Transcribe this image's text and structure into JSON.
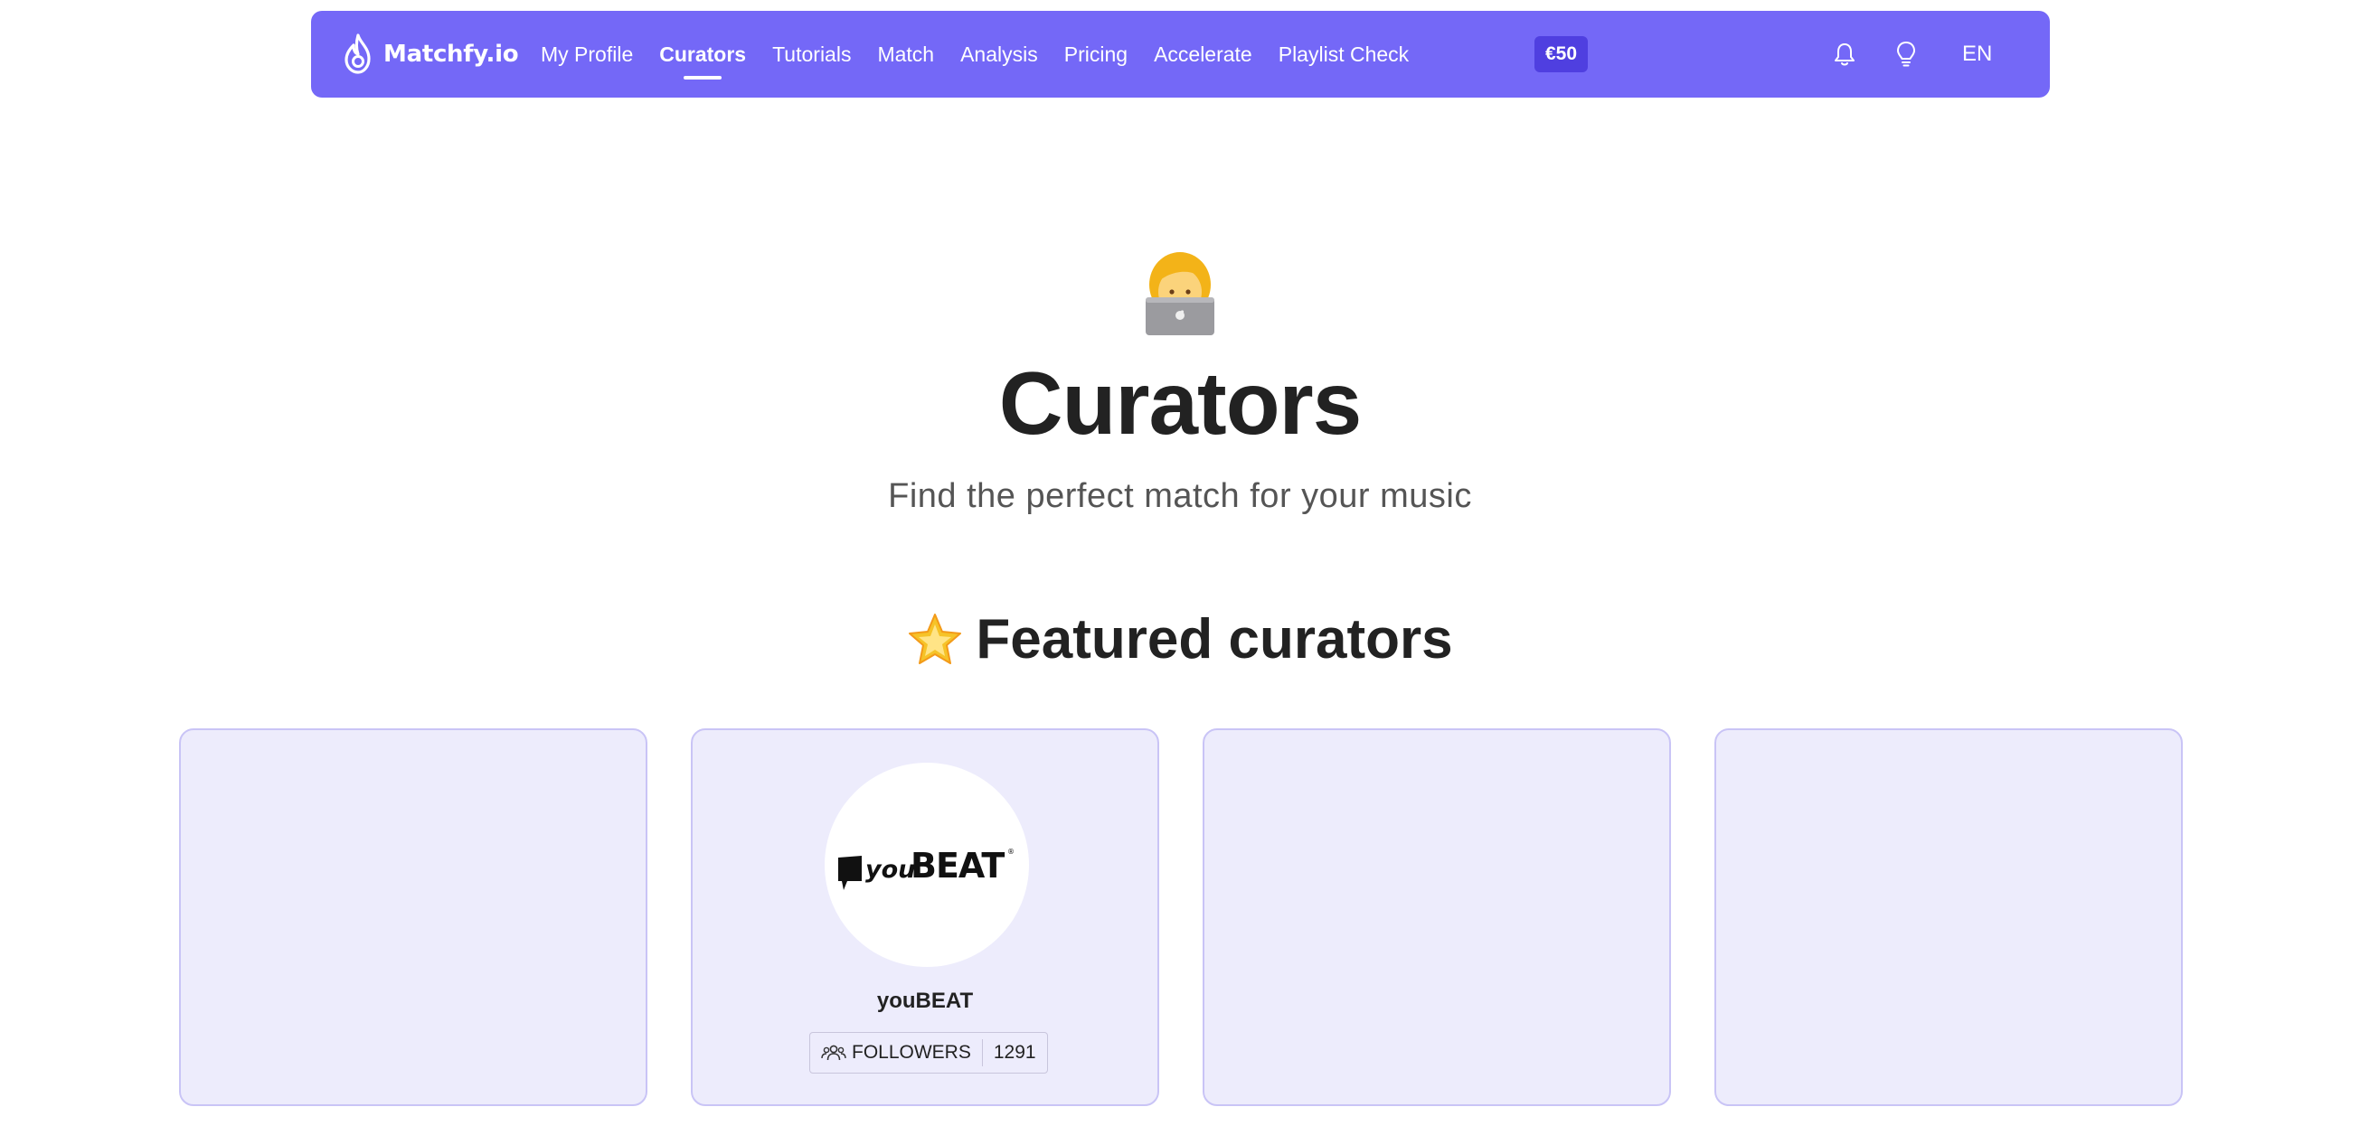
{
  "nav": {
    "logo_text": "Matchfy.io",
    "links": [
      "My Profile",
      "Curators",
      "Tutorials",
      "Match",
      "Analysis",
      "Pricing",
      "Accelerate",
      "Playlist Check"
    ],
    "active_link": "Curators",
    "credit_badge": "€50",
    "language": "EN",
    "icons": [
      "flame-logo-icon",
      "bell-icon",
      "lightbulb-icon"
    ]
  },
  "hero": {
    "emoji": "woman-technologist-emoji",
    "title": "Curators",
    "subtitle": "Find the perfect match for your music"
  },
  "featured": {
    "title": "Featured curators",
    "icon": "glowing-star-emoji",
    "cards": [
      {
        "name": "",
        "followers_label": "",
        "followers_count": ""
      },
      {
        "name": "youBEAT",
        "logo_text": "youBEAT",
        "followers_label": "FOLLOWERS",
        "followers_count": "1291"
      },
      {
        "name": "",
        "followers_label": "",
        "followers_count": ""
      },
      {
        "name": "",
        "followers_label": "",
        "followers_count": ""
      }
    ]
  },
  "colors": {
    "navbar_bg": "#7468f7",
    "badge_bg": "#4f3fe0",
    "card_bg": "#edecfc",
    "card_border": "#c9c4f6"
  }
}
